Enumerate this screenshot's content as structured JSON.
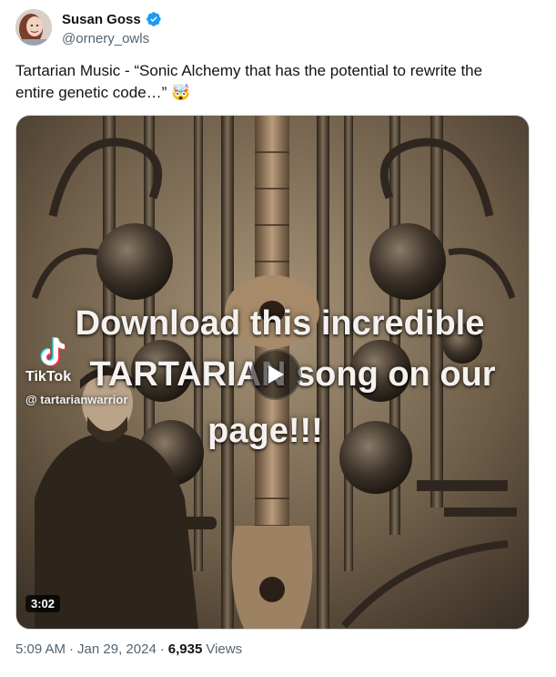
{
  "author": {
    "display_name": "Susan Goss",
    "handle": "@ornery_owls",
    "verified": true,
    "verified_color": "#1d9bf0"
  },
  "tweet": {
    "text_line1": "Tartarian Music - “Sonic Alchemy that has the potential to rewrite the",
    "text_line2": "entire genetic code…”",
    "emoji": "🤯"
  },
  "media": {
    "type": "video",
    "overlay_line1": "Download this incredible",
    "overlay_line2": "TARTARIAN song on our",
    "overlay_line3": "page!!!",
    "watermark_brand": "TikTok",
    "watermark_user": "@ tartarianwarrior",
    "duration": "3:02",
    "play_icon": "play-icon"
  },
  "meta": {
    "time": "5:09 AM",
    "separator": "·",
    "date": "Jan 29, 2024",
    "views_count": "6,935",
    "views_label": "Views"
  }
}
